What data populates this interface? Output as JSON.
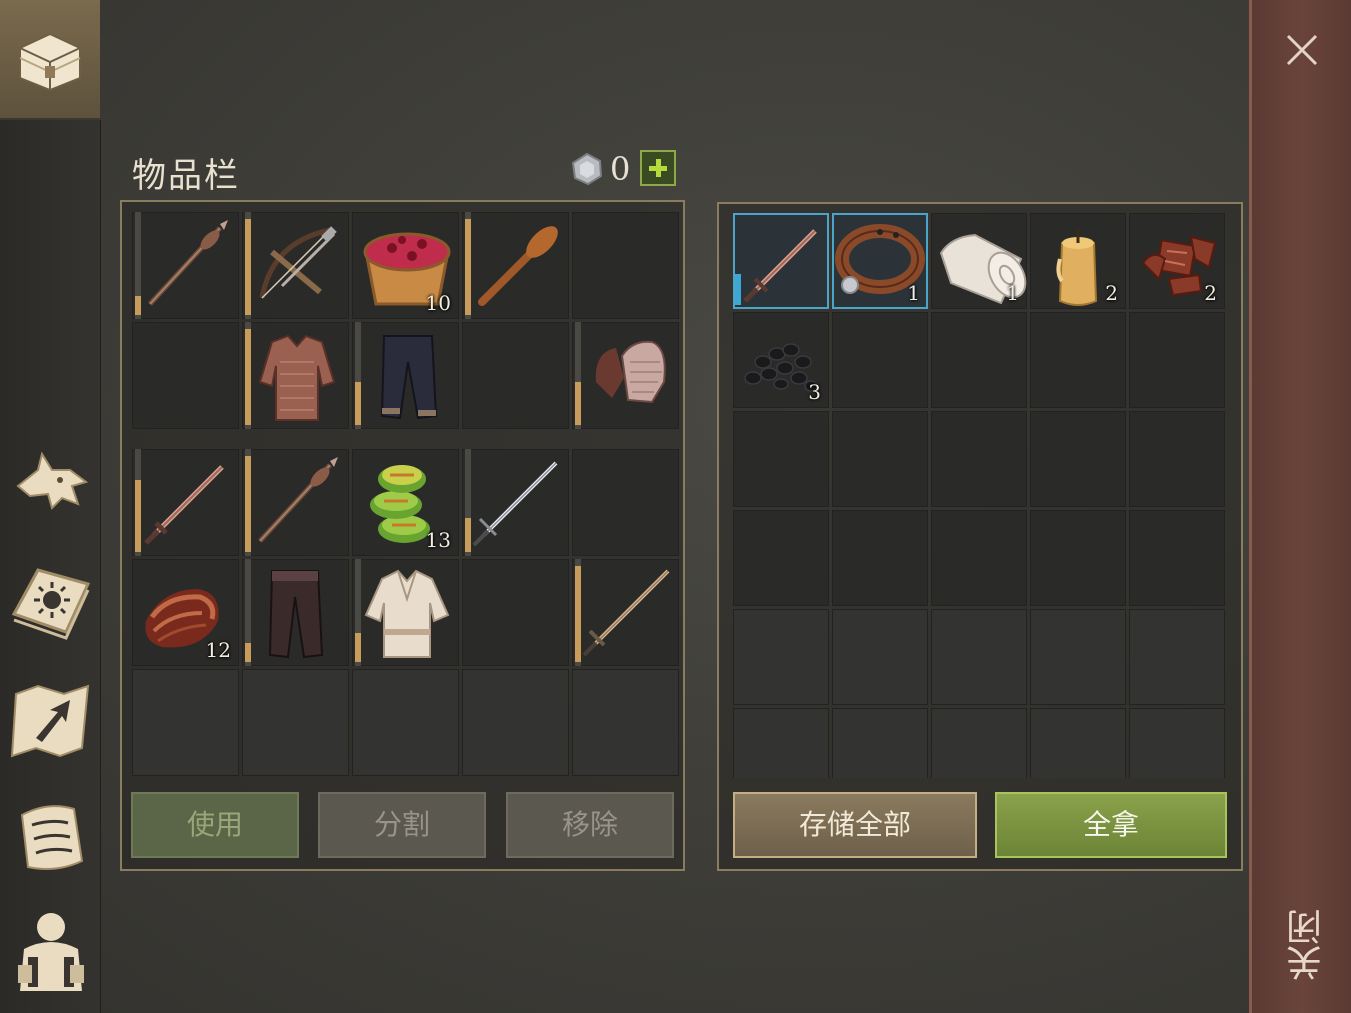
{
  "sidebar": {
    "active_tab_icon": "chest-icon",
    "items": [
      {
        "name": "wolf-icon"
      },
      {
        "name": "sun-book-icon"
      },
      {
        "name": "map-arrow-icon"
      },
      {
        "name": "scroll-icon"
      },
      {
        "name": "backpack-character-icon"
      }
    ]
  },
  "inventory": {
    "title": "物品栏",
    "currency_value": "0",
    "currency_icon": "silver-coin-icon",
    "buttons": {
      "use": "使用",
      "split": "分割",
      "remove": "移除"
    },
    "equipped": [
      {
        "icon": "mace-spear-icon",
        "count": "",
        "durability": 0.2
      },
      {
        "icon": "crossbow-icon",
        "count": "",
        "durability": 1.0
      },
      {
        "icon": "berry-bowl-icon",
        "count": "10",
        "durability": null
      },
      {
        "icon": "wooden-club-icon",
        "count": "",
        "durability": 1.0
      },
      {
        "icon": "",
        "count": "",
        "durability": null
      },
      {
        "icon": "",
        "count": "",
        "durability": null
      },
      {
        "icon": "chainmail-shirt-icon",
        "count": "",
        "durability": 1.0
      },
      {
        "icon": "dark-pants-icon",
        "count": "",
        "durability": 0.45
      },
      {
        "icon": "",
        "count": "",
        "durability": null
      },
      {
        "icon": "chainmail-gloves-icon",
        "count": "",
        "durability": 0.45
      }
    ],
    "backpack": [
      {
        "icon": "copper-sword-icon",
        "count": "",
        "durability": 0.75
      },
      {
        "icon": "mace-spear-icon",
        "count": "",
        "durability": 1.0
      },
      {
        "icon": "herb-cake-icon",
        "count": "13",
        "durability": null
      },
      {
        "icon": "steel-sword-icon",
        "count": "",
        "durability": 0.35
      },
      {
        "icon": "",
        "count": "",
        "durability": null
      },
      {
        "icon": "raw-meat-icon",
        "count": "12",
        "durability": null
      },
      {
        "icon": "leather-pants-icon",
        "count": "",
        "durability": 0.2
      },
      {
        "icon": "linen-shirt-icon",
        "count": "",
        "durability": 0.3
      },
      {
        "icon": "",
        "count": "",
        "durability": null
      },
      {
        "icon": "bronze-sword-icon",
        "count": "",
        "durability": 1.0
      }
    ],
    "locked_slots": 5
  },
  "container": {
    "buttons": {
      "store_all": "存储全部",
      "take_all": "全拿"
    },
    "items": [
      {
        "icon": "copper-dagger-icon",
        "count": "",
        "cooldown": 0.35,
        "selected": true
      },
      {
        "icon": "leather-collar-icon",
        "count": "1",
        "selected": true
      },
      {
        "icon": "cloth-roll-icon",
        "count": "1"
      },
      {
        "icon": "candle-icon",
        "count": "2"
      },
      {
        "icon": "scrap-metal-icon",
        "count": "2"
      },
      {
        "icon": "coal-icon",
        "count": "3"
      }
    ],
    "active_slots": 20,
    "dim_slots": 10
  },
  "close": {
    "label": "关闭",
    "icon": "close-icon"
  },
  "colors": {
    "durability": "#c89d5c",
    "selected": "#4aa6c8",
    "take_all": "#8aa24a",
    "close_bar": "#6a443a"
  }
}
